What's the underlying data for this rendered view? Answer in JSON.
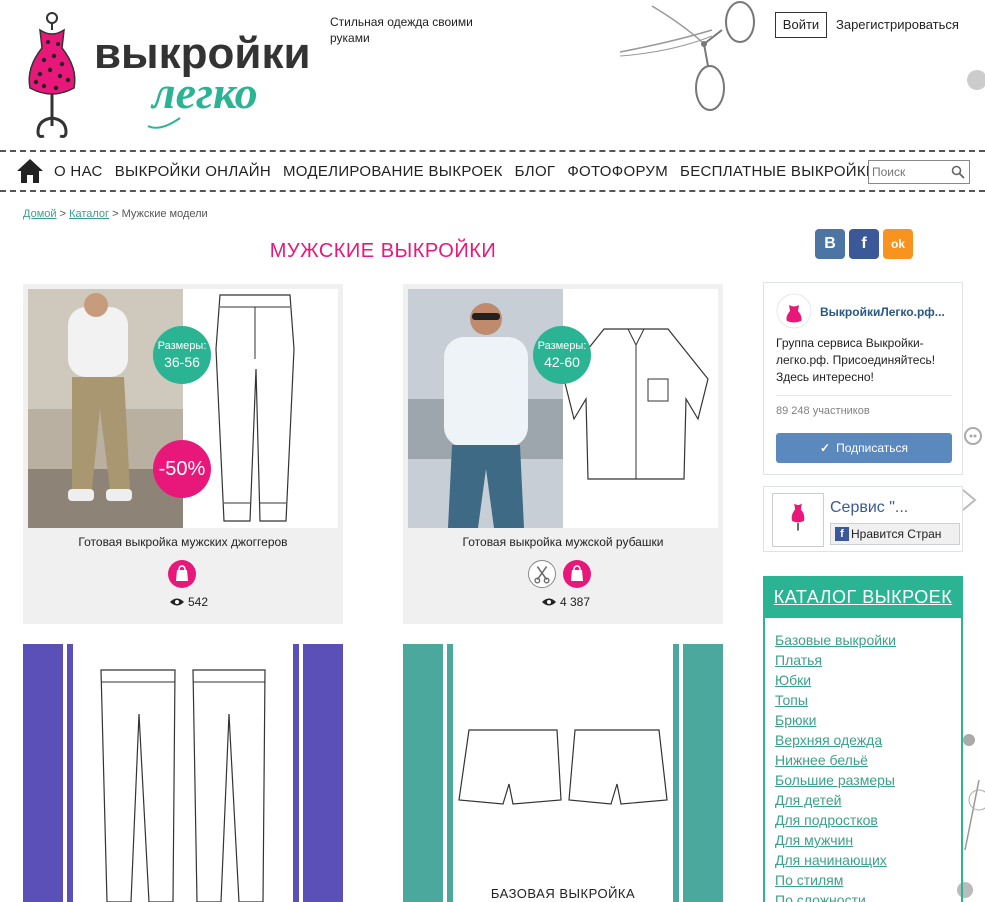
{
  "header": {
    "tagline": "Стильная одежда своими руками",
    "login_label": "Войти",
    "register_label": "Зарегистрироваться",
    "logo_text_1": "выкройки",
    "logo_text_2": "легко"
  },
  "nav": {
    "items": [
      "О НАС",
      "ВЫКРОЙКИ ОНЛАЙН",
      "МОДЕЛИРОВАНИЕ ВЫКРОЕК",
      "БЛОГ",
      "ФОТОФОРУМ",
      "БЕСПЛАТНЫЕ ВЫКРОЙКИ"
    ],
    "search_placeholder": "Поиск"
  },
  "breadcrumb": {
    "home": "Домой",
    "sep1": " > ",
    "catalog": "Каталог",
    "sep2": " > ",
    "current": "Мужские модели"
  },
  "page_title": "МУЖСКИЕ ВЫКРОЙКИ",
  "products": [
    {
      "title": "Готовая выкройка мужских джоггеров",
      "sizes_label": "Размеры:",
      "sizes": "36-56",
      "sale": "-50%",
      "views": "542"
    },
    {
      "title": "Готовая выкройка мужской рубашки",
      "sizes_label": "Размеры:",
      "sizes": "42-60",
      "views": "4 387"
    },
    {
      "title": "",
      "views": ""
    },
    {
      "title": "БАЗОВАЯ ВЫКРОЙКА",
      "views": ""
    }
  ],
  "social": {
    "vk": "B",
    "fb": "f",
    "ok": "ok"
  },
  "vk_widget": {
    "name": "ВыкройкиЛегко.рф...",
    "description": "Группа сервиса Выкройки-легко.рф. Присоединяйтесь! Здесь интересно!",
    "members": "89 248 участников",
    "subscribe": "Подписаться"
  },
  "fb_widget": {
    "name": "Сервис \"...",
    "like": "Нравится Стран"
  },
  "catalog": {
    "title": "КАТАЛОГ ВЫКРОЕК",
    "items": [
      "Базовые выкройки",
      "Платья",
      "Юбки",
      "Топы",
      "Брюки",
      "Верхняя одежда",
      "Нижнее бельё",
      "Большие размеры",
      "Для детей",
      "Для подростков",
      "Для мужчин",
      "Для начинающих",
      "По стилям",
      "По сложности"
    ]
  },
  "colors": {
    "accent_pink": "#e8177a",
    "accent_green": "#2bb493",
    "link": "#3aa28a",
    "vk": "#5b88bd",
    "purple_stripe": "#5b4fb8",
    "teal_stripe": "#4aa89c"
  }
}
